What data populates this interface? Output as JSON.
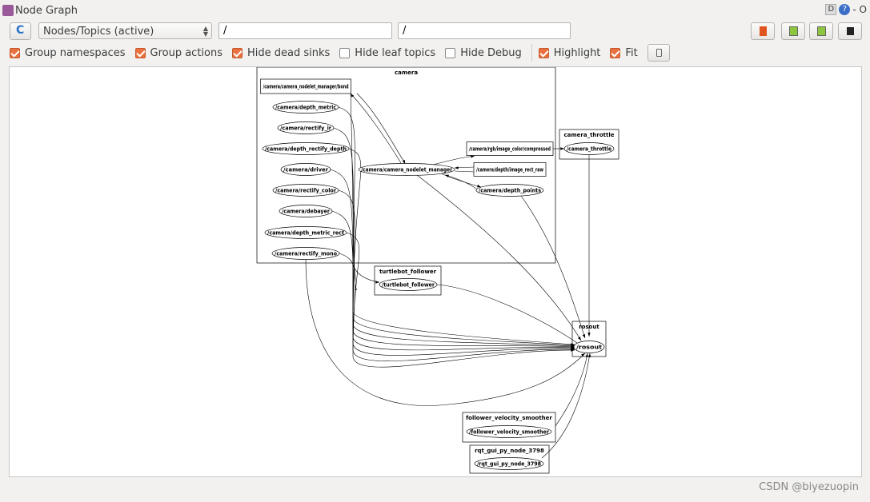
{
  "window": {
    "title": "Node Graph",
    "debug_label": "D",
    "help_label": "?",
    "minimize_label": "- O"
  },
  "toolbar": {
    "refresh_icon": "refresh-icon",
    "graph_type": "Nodes/Topics (active)",
    "node_filter": "/",
    "topic_filter": "/",
    "right_buttons": [
      "load-dot-icon",
      "save-dot-icon",
      "save-svg-icon",
      "save-image-icon"
    ]
  },
  "options": [
    {
      "label": "Group namespaces",
      "checked": true
    },
    {
      "label": "Group actions",
      "checked": true
    },
    {
      "label": "Hide dead sinks",
      "checked": true
    },
    {
      "label": "Hide leaf topics",
      "checked": false
    },
    {
      "label": "Hide Debug",
      "checked": false
    },
    {
      "label": "Highlight",
      "checked": true
    },
    {
      "label": "Fit",
      "checked": true
    }
  ],
  "fit_button_icon": "fit-view-icon",
  "graph": {
    "clusters": [
      "camera",
      "camera_throttle",
      "turtlebot_follower",
      "rosout",
      "follower_velocity_smoother",
      "rqt_gui_py_node_3798"
    ],
    "nodes": [
      "/camera/camera_nodelet_manager/bond",
      "/camera/depth_metric",
      "/camera/rectify_ir",
      "/camera/depth_rectify_depth",
      "/camera/driver",
      "/camera/rectify_color",
      "/camera/debayer",
      "/camera/depth_metric_rect",
      "/camera/rectify_mono",
      "/camera/camera_nodelet_manager",
      "/camera/rgb/image_color/compressed",
      "/camera/depth/image_rect_raw",
      "/camera/depth_points",
      "/camera_throttle",
      "/turtlebot_follower",
      "/rosout",
      "/follower_velocity_smoother",
      "/rqt_gui_py_node_3798"
    ]
  },
  "watermark": "CSDN @biyezuopin"
}
